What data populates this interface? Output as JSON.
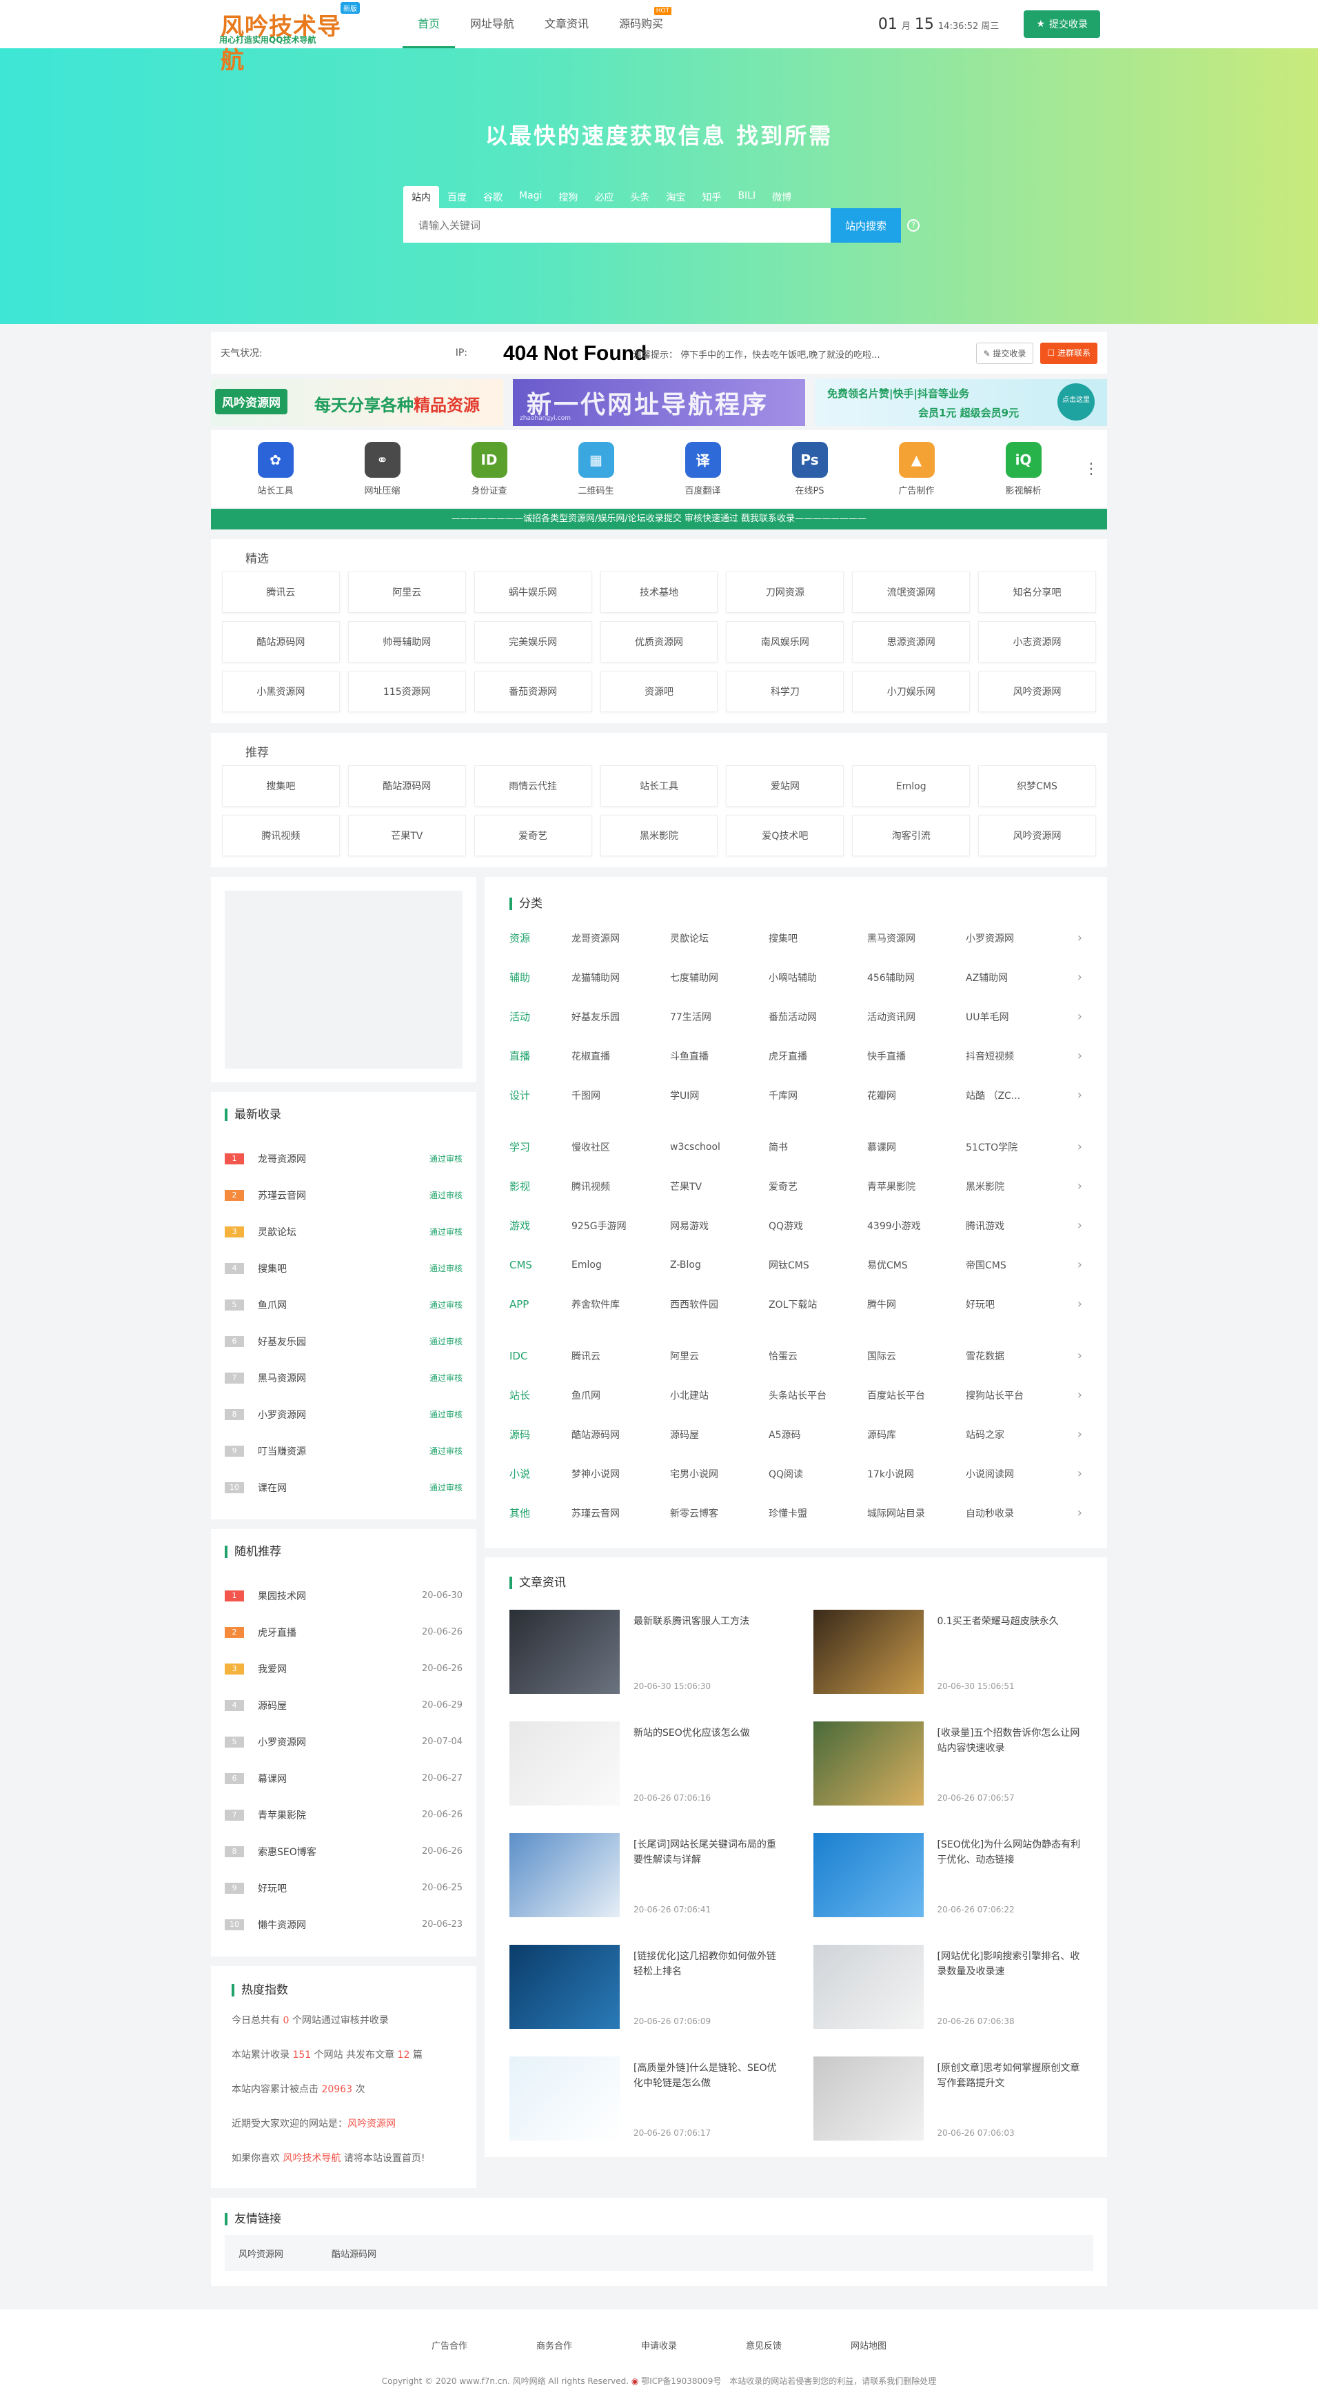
{
  "header": {
    "logo_main": "风吟技术导航",
    "logo_sub": "用心打造实用QQ技术导航",
    "logo_badge": "新版",
    "nav": [
      {
        "label": "首页"
      },
      {
        "label": "网址导航"
      },
      {
        "label": "文章资讯"
      },
      {
        "label": "源码购买"
      }
    ],
    "nav_hot": "HOT",
    "date_month": "01",
    "date_month_unit": "月",
    "date_day": "15",
    "date_time": "14:36:52 周三",
    "submit_label": "提交收录"
  },
  "hero": {
    "slogan": "以最快的速度获取信息 找到所需",
    "tabs": [
      "站内",
      "百度",
      "谷歌",
      "Magi",
      "搜狗",
      "必应",
      "头条",
      "淘宝",
      "知乎",
      "BILI",
      "微博"
    ],
    "placeholder": "请输入关键词",
    "search_button": "站内搜索"
  },
  "infostrip": {
    "weather": "天气状况:",
    "ip": "IP:",
    "not_found": "404 Not Found",
    "tip": "温馨提示：    停下手中的工作，快去吃午饭吧,晚了就没的吃啦...",
    "btn_submit": "提交收录",
    "btn_feedback": "进群联系"
  },
  "banners": {
    "b1_logo": "风吟资源网",
    "b1_text": "每天分享各种",
    "b1_em": "精品资源",
    "b2_text": "新一代网址导航程序",
    "b2_small": "zhaohangyi.com",
    "b3_text": "免费领名片赞|快手|抖音等业务",
    "b3_text2": "会员1元 超级会员9元",
    "b3_circle": "点击这里"
  },
  "tools": [
    {
      "label": "站长工具",
      "icon": "paw-icon",
      "color": "#2b63d9",
      "glyph": "✿"
    },
    {
      "label": "网址压缩",
      "icon": "link-icon",
      "color": "#4a4a4a",
      "glyph": "⚭"
    },
    {
      "label": "身份证查",
      "icon": "idcard-icon",
      "color": "#5aa02c",
      "glyph": "ID"
    },
    {
      "label": "二维码生",
      "icon": "qrcode-icon",
      "color": "#3aa7e0",
      "glyph": "▦"
    },
    {
      "label": "百度翻译",
      "icon": "translate-icon",
      "color": "#2f6bd8",
      "glyph": "译"
    },
    {
      "label": "在线PS",
      "icon": "photoshop-icon",
      "color": "#2d5fa8",
      "glyph": "Ps"
    },
    {
      "label": "广告制作",
      "icon": "image-icon",
      "color": "#f4a233",
      "glyph": "▲"
    },
    {
      "label": "影视解析",
      "icon": "iqiyi-icon",
      "color": "#28b34a",
      "glyph": "iQ"
    }
  ],
  "tools_more": "⋮",
  "notice": "————————诚招各类型资源网/娱乐网/论坛收录提交 审核快速通过 戳我联系收录————————",
  "featured": {
    "title": "精选",
    "items": [
      "腾讯云",
      "阿里云",
      "蜗牛娱乐网",
      "技术基地",
      "刀网资源",
      "流氓资源网",
      "知名分享吧",
      "酷站源码网",
      "帅哥辅助网",
      "完美娱乐网",
      "优质资源网",
      "南风娱乐网",
      "思源资源网",
      "小志资源网",
      "小黑资源网",
      "115资源网",
      "番茄资源网",
      "资源吧",
      "科学刀",
      "小刀娱乐网",
      "风吟资源网"
    ]
  },
  "recommend": {
    "title": "推荐",
    "items": [
      "搜集吧",
      "酷站源码网",
      "雨情云代挂",
      "站长工具",
      "爱站网",
      "Emlog",
      "织梦CMS",
      "腾讯视频",
      "芒果TV",
      "爱奇艺",
      "黑米影院",
      "爱Q技术吧",
      "淘客引流",
      "风吟资源网"
    ]
  },
  "latest": {
    "title": "最新收录",
    "items": [
      {
        "n": "1",
        "name": "龙哥资源网",
        "status": "通过审核"
      },
      {
        "n": "2",
        "name": "苏瑾云音网",
        "status": "通过审核"
      },
      {
        "n": "3",
        "name": "灵歆论坛",
        "status": "通过审核"
      },
      {
        "n": "4",
        "name": "搜集吧",
        "status": "通过审核"
      },
      {
        "n": "5",
        "name": "鱼爪网",
        "status": "通过审核"
      },
      {
        "n": "6",
        "name": "好基友乐园",
        "status": "通过审核"
      },
      {
        "n": "7",
        "name": "黑马资源网",
        "status": "通过审核"
      },
      {
        "n": "8",
        "name": "小罗资源网",
        "status": "通过审核"
      },
      {
        "n": "9",
        "name": "叮当赚资源",
        "status": "通过审核"
      },
      {
        "n": "10",
        "name": "课在网",
        "status": "通过审核"
      }
    ]
  },
  "random": {
    "title": "随机推荐",
    "items": [
      {
        "n": "1",
        "name": "果园技术网",
        "date": "20-06-30"
      },
      {
        "n": "2",
        "name": "虎牙直播",
        "date": "20-06-26"
      },
      {
        "n": "3",
        "name": "我爱网",
        "date": "20-06-26"
      },
      {
        "n": "4",
        "name": "源码屋",
        "date": "20-06-29"
      },
      {
        "n": "5",
        "name": "小罗资源网",
        "date": "20-07-04"
      },
      {
        "n": "6",
        "name": "幕课网",
        "date": "20-06-27"
      },
      {
        "n": "7",
        "name": "青苹果影院",
        "date": "20-06-26"
      },
      {
        "n": "8",
        "name": "索惠SEO博客",
        "date": "20-06-26"
      },
      {
        "n": "9",
        "name": "好玩吧",
        "date": "20-06-25"
      },
      {
        "n": "10",
        "name": "懒牛资源网",
        "date": "20-06-23"
      }
    ]
  },
  "hot": {
    "title": "热度指数",
    "l1a": "今日总共有 ",
    "l1n": "0",
    "l1b": " 个网站通过审核并收录",
    "l2a": "本站累计收录 ",
    "l2n": "151",
    "l2b": " 个网站 共发布文章 ",
    "l2m": "12",
    "l2c": " 篇",
    "l3a": "本站内容累计被点击 ",
    "l3n": "20963",
    "l3b": " 次",
    "l4a": "近期受大家欢迎的网站是：",
    "l4n": "风吟资源网",
    "l5a": "如果你喜欢 ",
    "l5n": "风吟技术导航",
    "l5b": " 请将本站设置首页!"
  },
  "categories": {
    "title": "分类",
    "groups": [
      [
        {
          "name": "资源",
          "items": [
            "龙哥资源网",
            "灵歆论坛",
            "搜集吧",
            "黑马资源网",
            "小罗资源网"
          ]
        },
        {
          "name": "辅助",
          "items": [
            "龙猫辅助网",
            "七度辅助网",
            "小嘀咕辅助",
            "456辅助网",
            "AZ辅助网"
          ]
        },
        {
          "name": "活动",
          "items": [
            "好基友乐园",
            "77生活网",
            "番茄活动网",
            "活动资讯网",
            "UU羊毛网"
          ]
        },
        {
          "name": "直播",
          "items": [
            "花椒直播",
            "斗鱼直播",
            "虎牙直播",
            "快手直播",
            "抖音短视频"
          ]
        },
        {
          "name": "设计",
          "items": [
            "千图网",
            "学UI网",
            "千库网",
            "花瓣网",
            "站酷 （ZC..."
          ]
        }
      ],
      [
        {
          "name": "学习",
          "items": [
            "慢收社区",
            "w3cschool",
            "简书",
            "慕课网",
            "51CTO学院"
          ]
        },
        {
          "name": "影视",
          "items": [
            "腾讯视频",
            "芒果TV",
            "爱奇艺",
            "青苹果影院",
            "黑米影院"
          ]
        },
        {
          "name": "游戏",
          "items": [
            "925G手游网",
            "网易游戏",
            "QQ游戏",
            "4399小游戏",
            "腾讯游戏"
          ]
        },
        {
          "name": "CMS",
          "items": [
            "Emlog",
            "Z-Blog",
            "网钛CMS",
            "易优CMS",
            "帝国CMS"
          ]
        },
        {
          "name": "APP",
          "items": [
            "养舍软件库",
            "西西软件园",
            "ZOL下载站",
            "腾牛网",
            "好玩吧"
          ]
        }
      ],
      [
        {
          "name": "IDC",
          "items": [
            "腾讯云",
            "阿里云",
            "恰蛋云",
            "国际云",
            "雪花数据"
          ]
        },
        {
          "name": "站长",
          "items": [
            "鱼爪网",
            "小北建站",
            "头条站长平台",
            "百度站长平台",
            "搜狗站长平台"
          ]
        },
        {
          "name": "源码",
          "items": [
            "酷站源码网",
            "源码屋",
            "A5源码",
            "源码库",
            "站码之家"
          ]
        },
        {
          "name": "小说",
          "items": [
            "梦神小说网",
            "宅男小说网",
            "QQ阅读",
            "17k小说网",
            "小说阅读网"
          ]
        },
        {
          "name": "其他",
          "items": [
            "苏瑾云音网",
            "新零云博客",
            "珍懂卡盟",
            "城际网站目录",
            "自动秒收录"
          ]
        }
      ]
    ],
    "arrow": "›"
  },
  "articles": {
    "title": "文章资讯",
    "items": [
      {
        "title": "最新联系腾讯客服人工方法",
        "date": "20-06-30 15:06:30"
      },
      {
        "title": "0.1买王者荣耀马超皮肤永久",
        "date": "20-06-30 15:06:51"
      },
      {
        "title": "新站的SEO优化应该怎么做",
        "date": "20-06-26 07:06:16"
      },
      {
        "title": "[收录量]五个招数告诉你怎么让网站内容快速收录",
        "date": "20-06-26 07:06:57"
      },
      {
        "title": "[长尾词]网站长尾关键词布局的重要性解读与详解",
        "date": "20-06-26 07:06:41"
      },
      {
        "title": "[SEO优化]为什么网站伪静态有利于优化、动态链接",
        "date": "20-06-26 07:06:22"
      },
      {
        "title": "[链接优化]这几招教你如何做外链轻松上排名",
        "date": "20-06-26 07:06:09"
      },
      {
        "title": "[网站优化]影响搜索引擎排名、收录数量及收录速",
        "date": "20-06-26 07:06:38"
      },
      {
        "title": "[高质量外链]什么是链轮、SEO优化中轮链是怎么做",
        "date": "20-06-26 07:06:17"
      },
      {
        "title": "[原创文章]思考如何掌握原创文章写作套路提升文",
        "date": "20-06-26 07:06:03"
      }
    ]
  },
  "friends": {
    "title": "友情链接",
    "items": [
      "风吟资源网",
      "酷站源码网"
    ]
  },
  "footer": {
    "nav": [
      "广告合作",
      "商务合作",
      "申请收录",
      "意见反馈",
      "网站地图"
    ],
    "copyright": "Copyright © 2020 www.f7n.cn. 风吟网络 All rights Reserved.",
    "icp": "鄂ICP备19038009号",
    "notice": "本站收录的网站若侵害到您的利益，请联系我们删除处理"
  }
}
